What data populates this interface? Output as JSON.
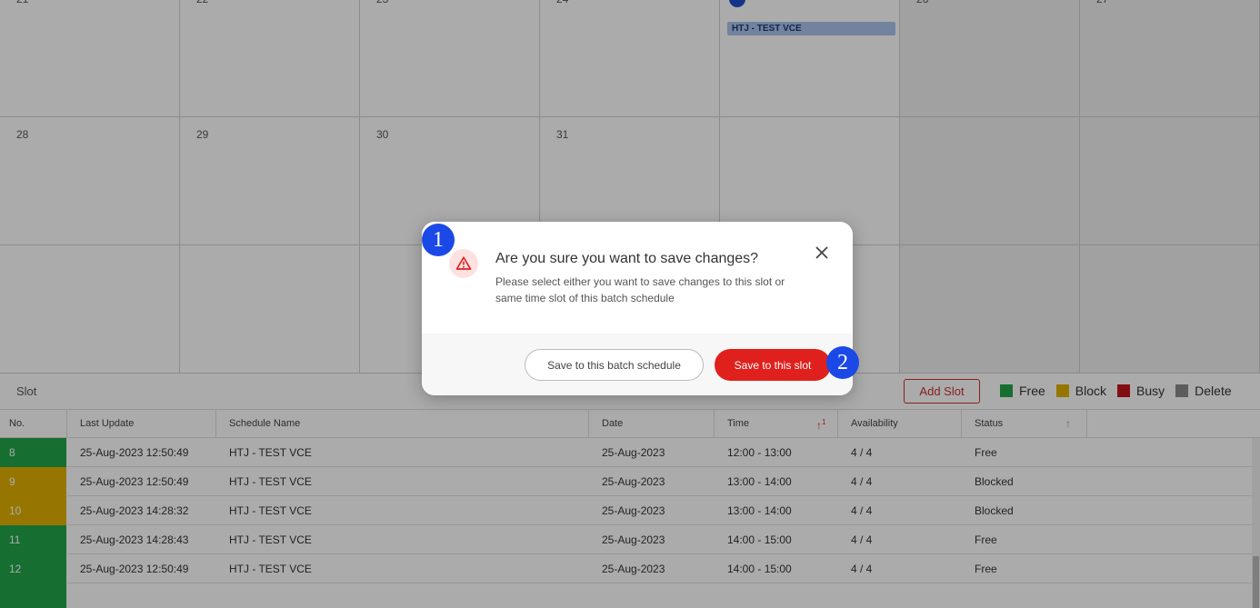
{
  "calendar": {
    "weeks": [
      [
        "21",
        "22",
        "23",
        "24",
        "25",
        "26",
        "27"
      ],
      [
        "28",
        "29",
        "30",
        "31",
        "",
        "",
        ""
      ],
      [
        "",
        "",
        "",
        "",
        "",
        "",
        ""
      ]
    ],
    "event_label": "HTJ - TEST VCE"
  },
  "slot_panel": {
    "title": "Slot",
    "add_slot_label": "Add Slot",
    "legend": [
      {
        "label": "Free",
        "color": "#22a64a"
      },
      {
        "label": "Block",
        "color": "#e0b000"
      },
      {
        "label": "Busy",
        "color": "#c0171b"
      },
      {
        "label": "Delete",
        "color": "#8a8a8a"
      }
    ]
  },
  "table": {
    "headers": [
      "No.",
      "Last Update",
      "Schedule Name",
      "Date",
      "Time",
      "Availability",
      "Status"
    ],
    "rows": [
      {
        "no": "8",
        "last_update": "25-Aug-2023 12:50:49",
        "schedule": "HTJ - TEST VCE",
        "date": "25-Aug-2023",
        "time": "12:00 - 13:00",
        "availability": "4 / 4",
        "status": "Free",
        "color": "#22a64a"
      },
      {
        "no": "9",
        "last_update": "25-Aug-2023 12:50:49",
        "schedule": "HTJ - TEST VCE",
        "date": "25-Aug-2023",
        "time": "13:00 - 14:00",
        "availability": "4 / 4",
        "status": "Blocked",
        "color": "#e0b000"
      },
      {
        "no": "10",
        "last_update": "25-Aug-2023 14:28:32",
        "schedule": "HTJ - TEST VCE",
        "date": "25-Aug-2023",
        "time": "13:00 - 14:00",
        "availability": "4 / 4",
        "status": "Blocked",
        "color": "#e0b000"
      },
      {
        "no": "11",
        "last_update": "25-Aug-2023 14:28:43",
        "schedule": "HTJ - TEST VCE",
        "date": "25-Aug-2023",
        "time": "14:00 - 15:00",
        "availability": "4 / 4",
        "status": "Free",
        "color": "#22a64a"
      },
      {
        "no": "12",
        "last_update": "25-Aug-2023 12:50:49",
        "schedule": "HTJ - TEST VCE",
        "date": "25-Aug-2023",
        "time": "14:00 - 15:00",
        "availability": "4 / 4",
        "status": "Free",
        "color": "#22a64a"
      }
    ]
  },
  "dialog": {
    "title": "Are you sure you want to save changes?",
    "message": "Please select either you want to save changes to this slot or same time slot of this batch schedule",
    "batch_button": "Save to this batch schedule",
    "slot_button": "Save to this slot",
    "badge_1": "1",
    "badge_2": "2",
    "icons": {
      "warning": "warning-triangle-icon",
      "close": "close-icon"
    },
    "accent_color": "#e0201d"
  }
}
